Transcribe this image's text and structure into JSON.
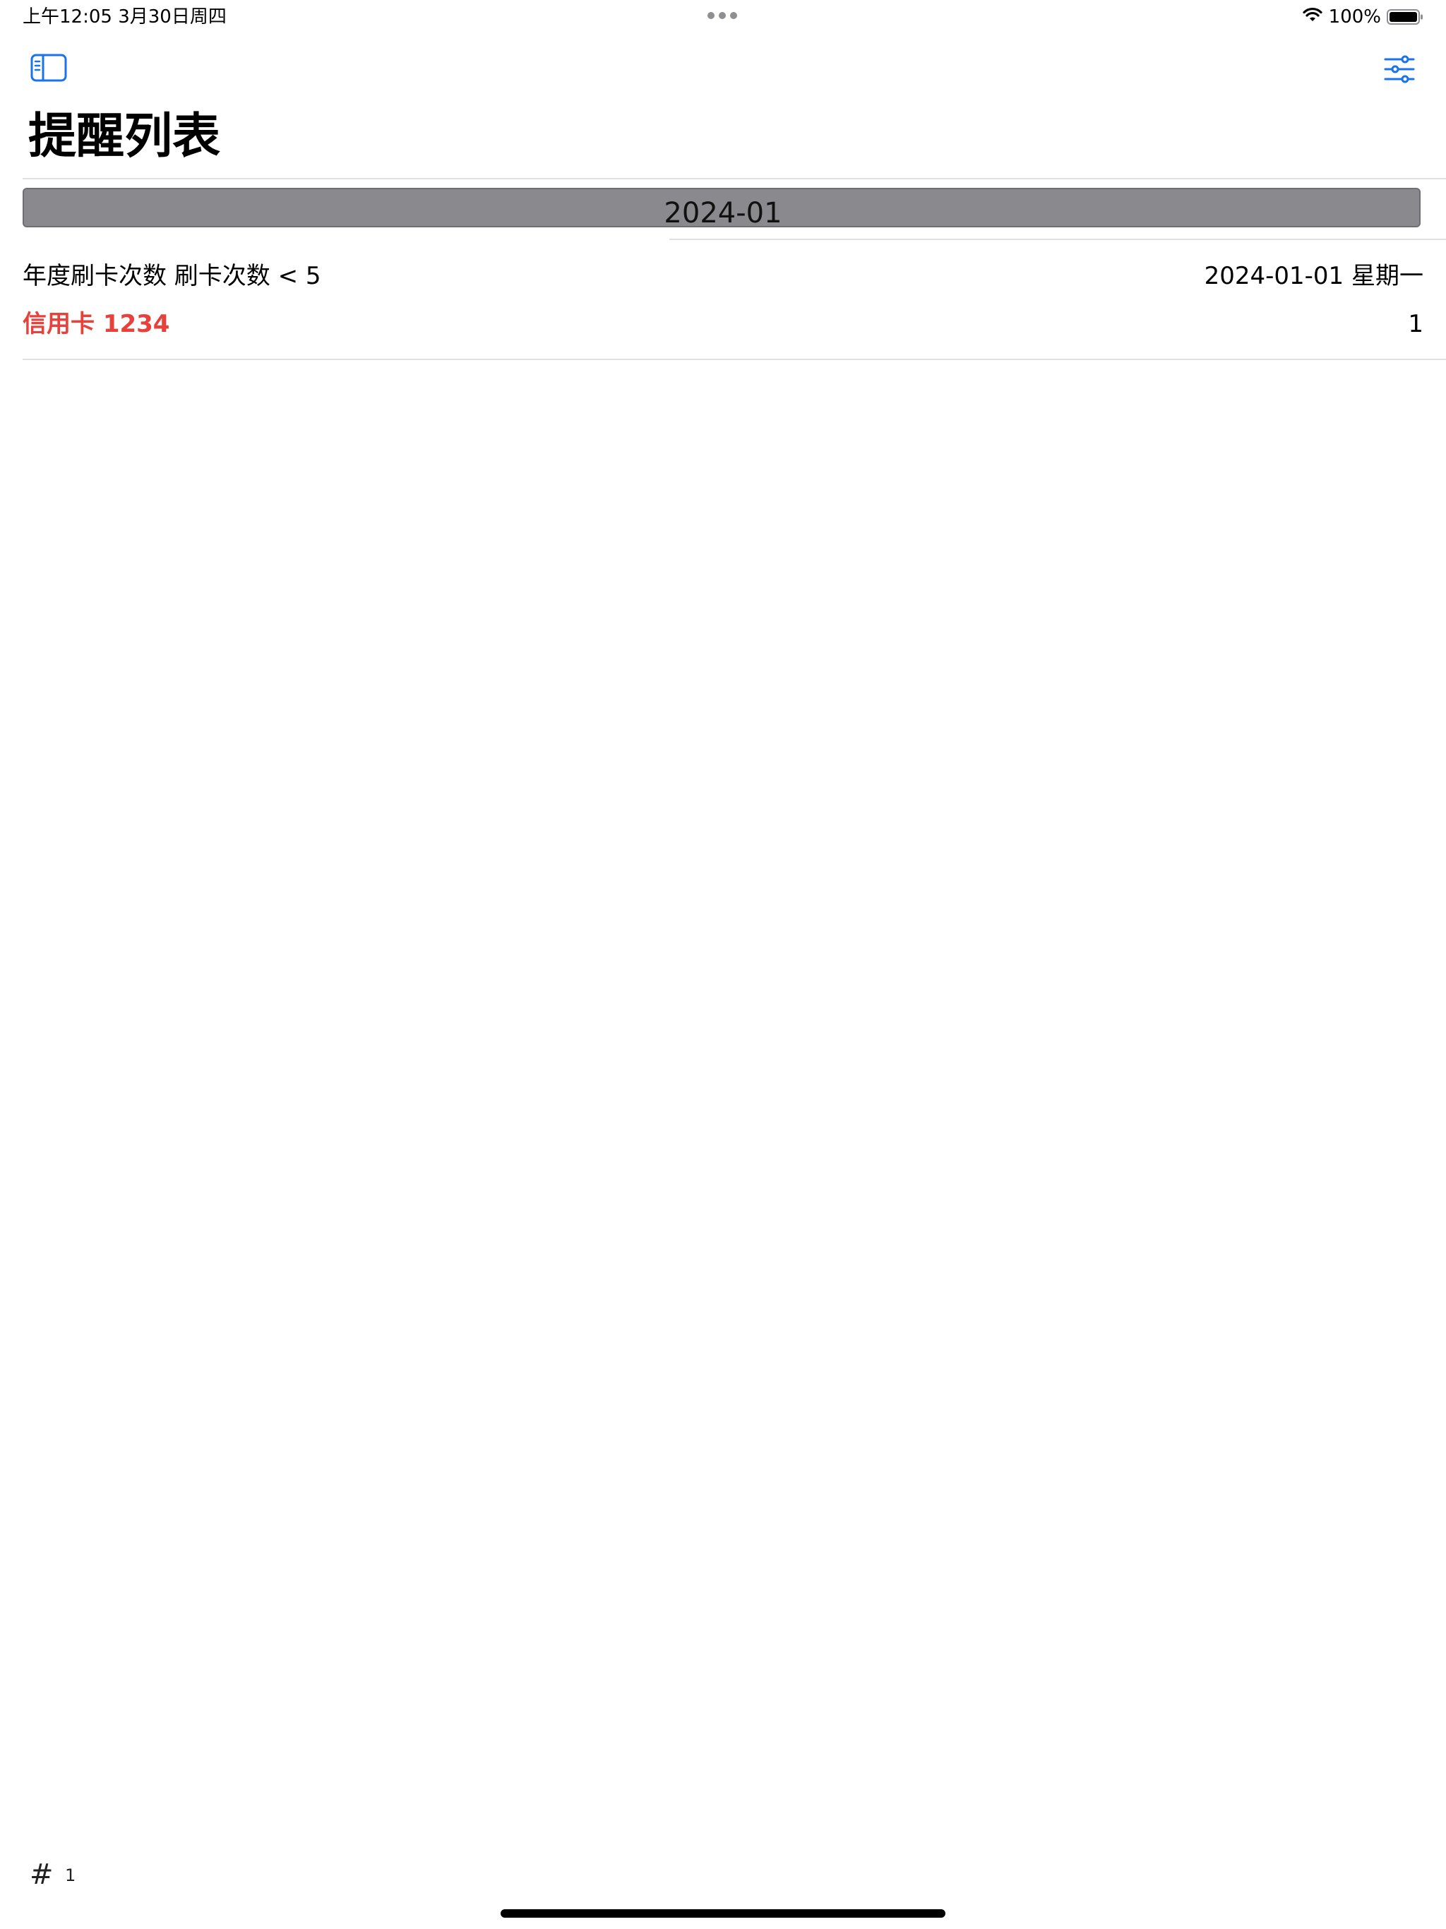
{
  "status_bar": {
    "time_date": "上午12:05   3月30日周四",
    "battery_percent": "100%",
    "battery_level": 1.0,
    "icons": [
      "wifi-icon",
      "battery-icon"
    ]
  },
  "nav": {
    "sidebar_toggle_icon": "sidebar-toggle-icon",
    "filter_icon": "sliders-filter-icon",
    "title": "提醒列表"
  },
  "sections": [
    {
      "header": "2024-01",
      "rows": [
        {
          "title": "年度刷卡次数  刷卡次数 < 5",
          "date": "2024-01-01 星期一",
          "card": "信用卡 1234",
          "count": "1"
        }
      ]
    }
  ],
  "footer": {
    "hash": "#",
    "count": "1"
  },
  "colors": {
    "accent": "#1a73e8",
    "card_red": "#e8403a",
    "section_header_bg": "#8a8a8e"
  }
}
